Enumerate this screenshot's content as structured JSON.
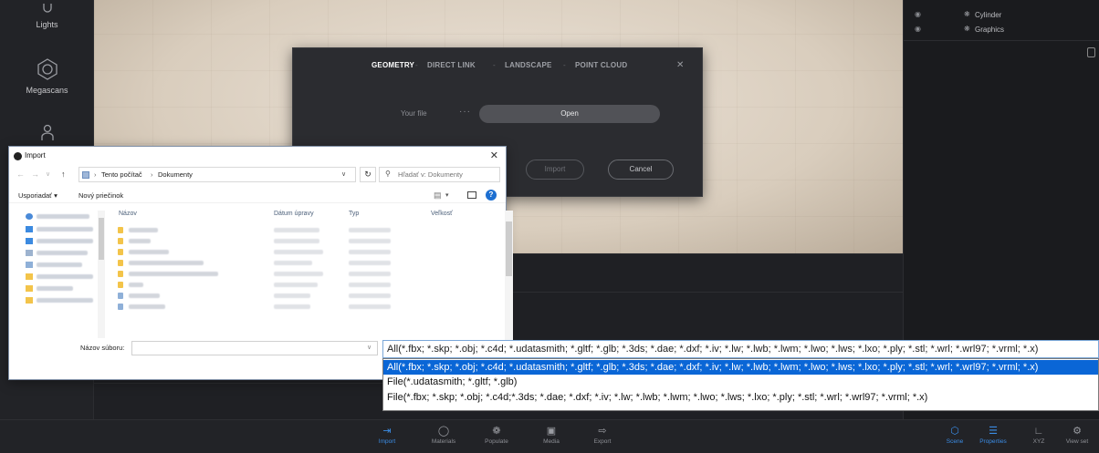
{
  "sidebar": {
    "items": [
      {
        "label": "Lights",
        "icon": "bulb-icon"
      },
      {
        "label": "Megascans",
        "icon": "megascans-icon"
      },
      {
        "label": "",
        "icon": "person-icon"
      }
    ]
  },
  "outliner": {
    "rows": [
      {
        "label": "Cylinder",
        "icon": "cube-icon"
      },
      {
        "label": "Graphics",
        "icon": "cube-icon"
      }
    ]
  },
  "ds_dialog": {
    "tabs": [
      "GEOMETRY",
      "DIRECT LINK",
      "LANDSCAPE",
      "POINT CLOUD"
    ],
    "active_tab": "GEOMETRY",
    "your_file_label": "Your file",
    "dots": "···",
    "open_button": "Open",
    "import_button": "Import",
    "cancel_button": "Cancel",
    "close_glyph": "✕"
  },
  "file_dialog": {
    "title": "Import",
    "close_glyph": "✕",
    "breadcrumb": [
      "Tento počítač",
      "Dokumenty"
    ],
    "search_placeholder": "Hľadať v: Dokumenty",
    "toolbar": {
      "organize": "Usporiadať ▾",
      "new_folder": "Nový priečinok"
    },
    "columns": [
      "Názov",
      "Dátum úpravy",
      "Typ",
      "Veľkosť"
    ],
    "file_name_label": "Názov súboru:",
    "file_name_value": ""
  },
  "file_types": {
    "selected": "All(*.fbx; *.skp; *.obj; *.c4d; *.udatasmith; *.gltf; *.glb; *.3ds; *.dae; *.dxf; *.iv; *.lw; *.lwb; *.lwm; *.lwo; *.lws; *.lxo; *.ply; *.stl; *.wrl; *.wrl97; *.vrml; *.x)",
    "options": [
      "All(*.fbx; *.skp; *.obj; *.c4d; *.udatasmith; *.gltf; *.glb; *.3ds; *.dae; *.dxf; *.iv; *.lw; *.lwb; *.lwm; *.lwo; *.lws; *.lxo; *.ply; *.stl; *.wrl; *.wrl97; *.vrml; *.x)",
      "File(*.udatasmith; *.gltf; *.glb)",
      "File(*.fbx; *.skp; *.obj; *.c4d;*.3ds; *.dae; *.dxf; *.iv; *.lw; *.lwb; *.lwm; *.lwo; *.lws; *.lxo; *.ply; *.stl; *.wrl; *.wrl97; *.vrml; *.x)"
    ]
  },
  "bottombar": {
    "left": [
      {
        "label": "Import",
        "icon": "import-icon",
        "active": true
      },
      {
        "label": "Materials",
        "icon": "materials-icon",
        "active": false
      },
      {
        "label": "Populate",
        "icon": "populate-icon",
        "active": false
      },
      {
        "label": "Media",
        "icon": "media-icon",
        "active": false
      },
      {
        "label": "Export",
        "icon": "export-icon",
        "active": false
      }
    ],
    "right": [
      {
        "label": "Scene",
        "icon": "scene-icon",
        "active": true
      },
      {
        "label": "Properties",
        "icon": "properties-icon",
        "active": true
      },
      {
        "label": "XYZ",
        "icon": "xyz-icon",
        "active": false
      },
      {
        "label": "View set",
        "icon": "view-settings-icon",
        "active": false
      }
    ]
  },
  "colors": {
    "accent": "#3b8de6",
    "selection": "#0a66d6"
  }
}
